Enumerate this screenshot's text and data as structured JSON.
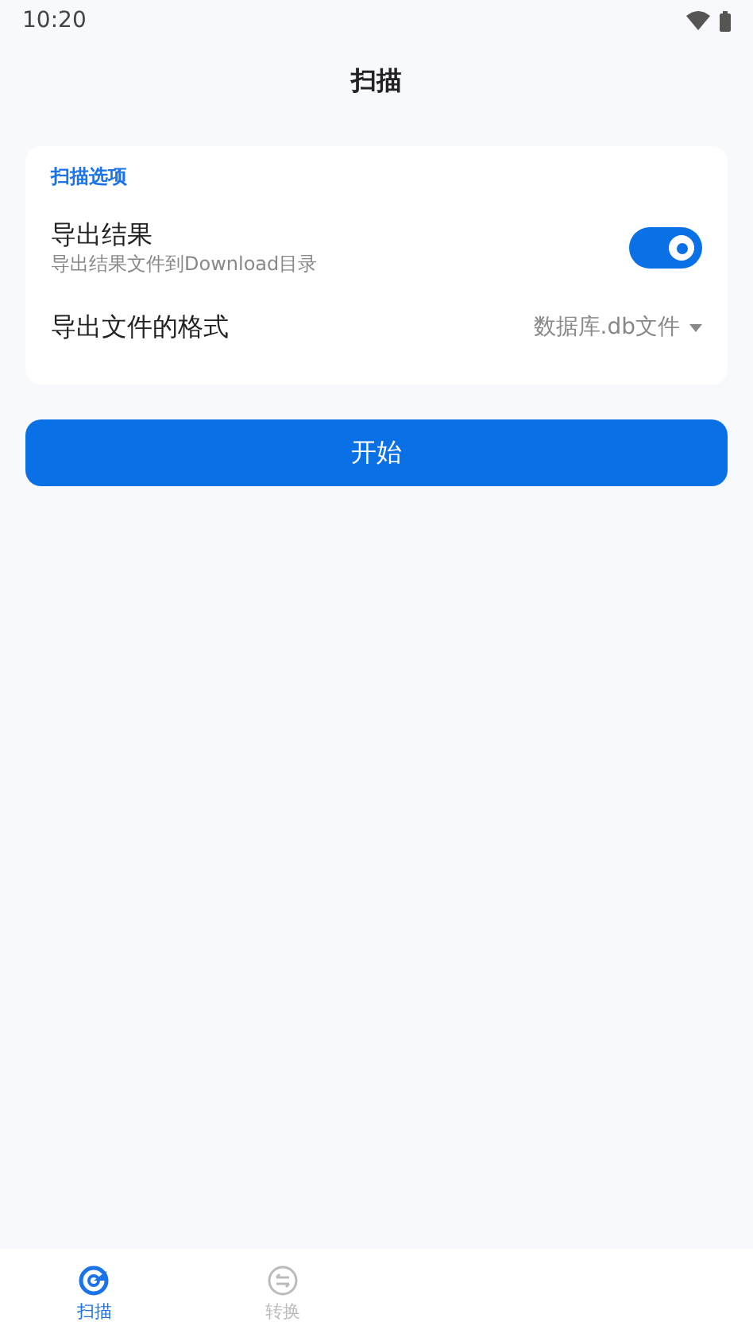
{
  "status_bar": {
    "time": "10:20"
  },
  "app_bar": {
    "title": "扫描"
  },
  "options_card": {
    "heading": "扫描选项",
    "items": [
      {
        "kind": "switch",
        "label": "导出结果",
        "description": "导出结果文件到Download目录",
        "on": true
      },
      {
        "kind": "dropdown",
        "label": "导出文件的格式",
        "value": "数据库.db文件"
      }
    ]
  },
  "start_button": {
    "label": "开始"
  },
  "bottom_nav": [
    {
      "label": "扫描",
      "kind": "scan",
      "selected": true
    },
    {
      "label": "转换",
      "kind": "convert",
      "selected": false
    }
  ]
}
